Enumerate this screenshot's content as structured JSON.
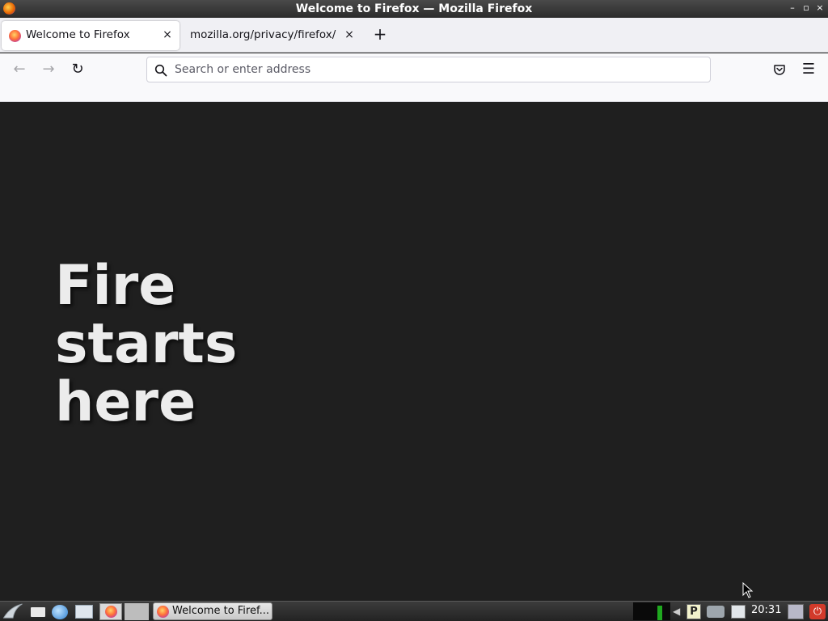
{
  "window": {
    "title": "Welcome to Firefox — Mozilla Firefox",
    "minimize": "–",
    "maximize": "▫",
    "close": "×"
  },
  "tabs": [
    {
      "label": "Welcome to Firefox",
      "active": true,
      "close": "×"
    },
    {
      "label": "mozilla.org/privacy/firefox/",
      "active": false,
      "close": "×"
    }
  ],
  "newtab_label": "+",
  "navbar": {
    "back": "←",
    "forward": "→",
    "reload": "↻",
    "url_placeholder": "Search or enter address",
    "url_value": "",
    "pocket": "pocket-icon",
    "menu": "☰"
  },
  "content": {
    "headline": [
      "Fire",
      "starts",
      "here"
    ],
    "background": "#1f1f1f"
  },
  "taskbar": {
    "task_label": "Welcome to Firef...",
    "clock": "20:31",
    "tray_p": "P"
  }
}
